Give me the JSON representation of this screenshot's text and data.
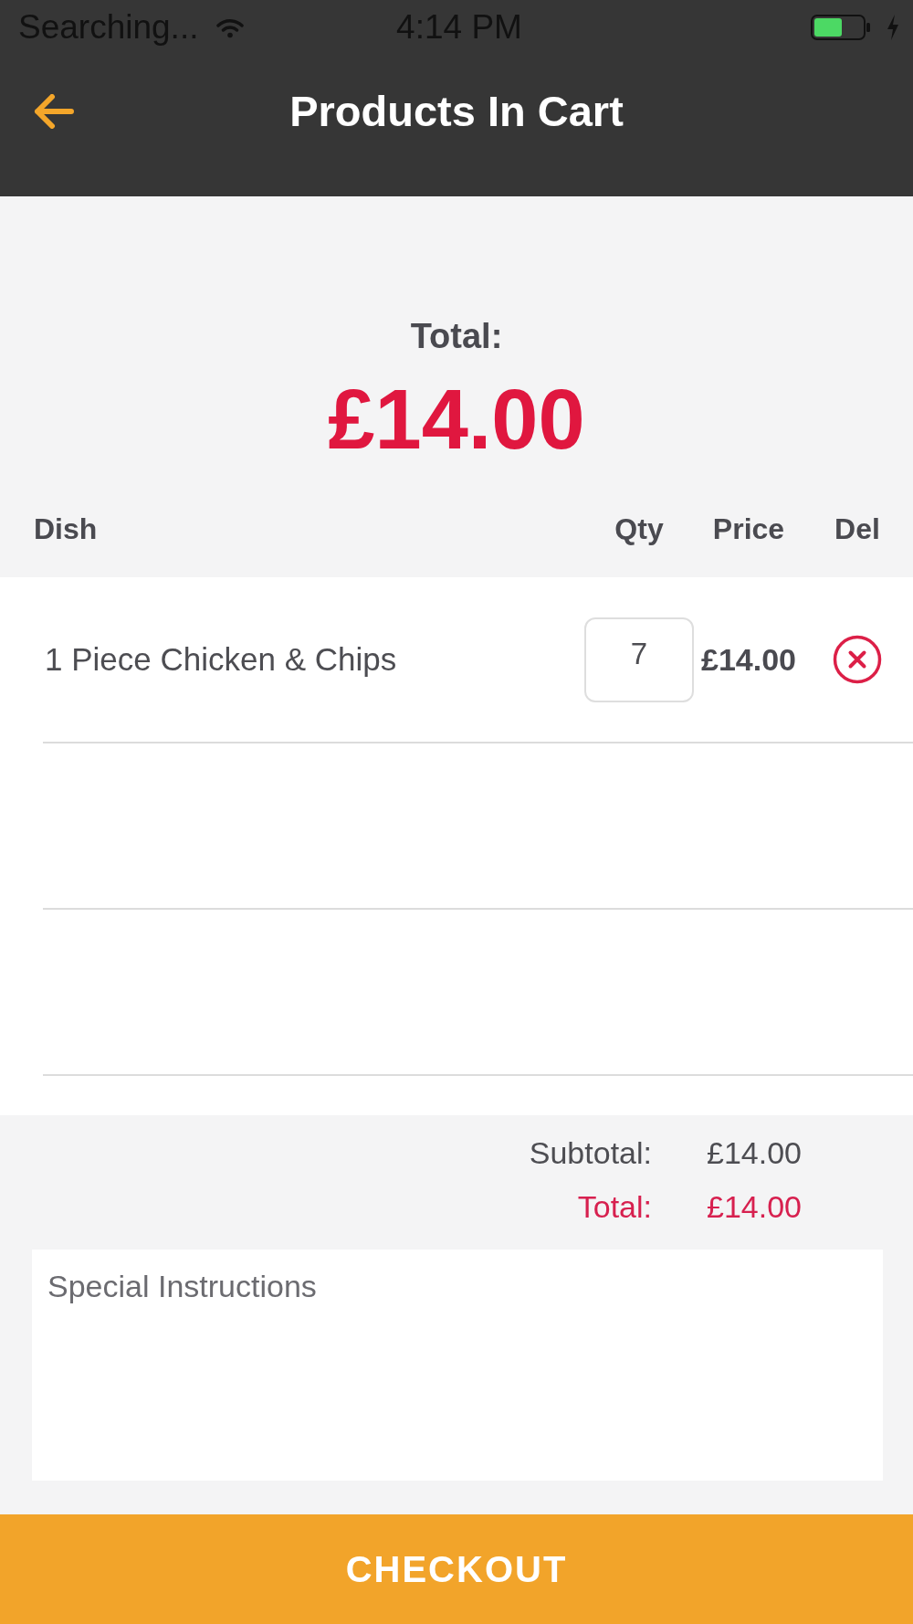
{
  "status_bar": {
    "carrier": "Searching...",
    "time": "4:14 PM"
  },
  "header": {
    "title": "Products In Cart"
  },
  "summary": {
    "label": "Total:",
    "amount": "£14.00"
  },
  "table": {
    "columns": [
      "Dish",
      "Qty",
      "Price",
      "Del"
    ],
    "rows": [
      {
        "dish": "1 Piece Chicken & Chips",
        "qty": "7",
        "price": "£14.00"
      }
    ]
  },
  "totals": [
    {
      "kind": "subtotal",
      "label": "Subtotal:",
      "value": "£14.00"
    },
    {
      "kind": "total",
      "label": "Total:",
      "value": "£14.00"
    }
  ],
  "instructions": {
    "placeholder": "Special Instructions"
  },
  "checkout_button": {
    "label": "CHECKOUT"
  }
}
